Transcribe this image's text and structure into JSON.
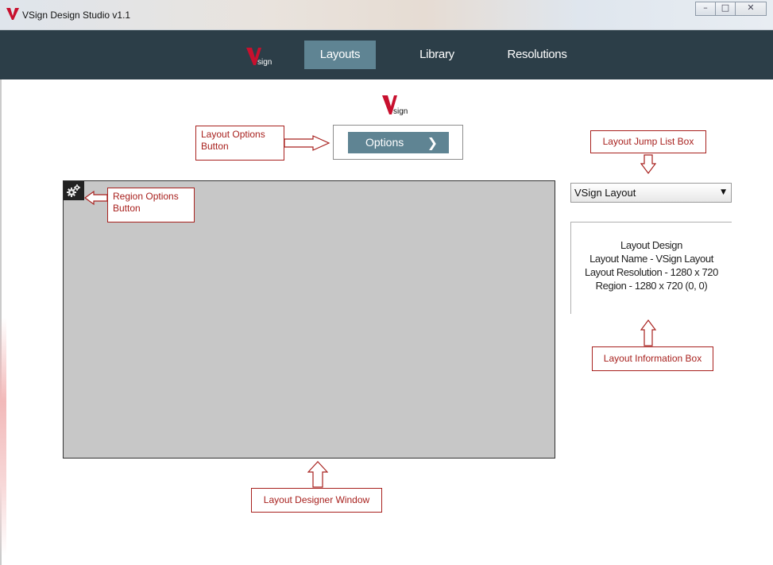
{
  "window": {
    "title": "VSign Design Studio v1.1",
    "controls": {
      "minimize": "–",
      "maximize": "□",
      "close": "✕"
    }
  },
  "nav": {
    "logo_text": "sign",
    "items": [
      {
        "label": "Layouts",
        "active": true
      },
      {
        "label": "Library",
        "active": false
      },
      {
        "label": "Resolutions",
        "active": false
      }
    ]
  },
  "center_logo_text": "sign",
  "options_button": {
    "label": "Options",
    "chevron": "❯"
  },
  "jump_list": {
    "selected": "VSign Layout",
    "caret": "▼"
  },
  "info_box": {
    "lines": [
      "Layout Design",
      "Layout Name - VSign Layout",
      "Layout Resolution - 1280 x 720",
      "Region - 1280 x 720 (0, 0)"
    ]
  },
  "callouts": {
    "layout_options": "Layout Options Button",
    "region_options": "Region Options Button",
    "jump_list": "Layout Jump List Box",
    "info_box": "Layout Information Box",
    "designer": "Layout Designer Window"
  },
  "colors": {
    "brand_red": "#c8102e",
    "navbar": "#2c3e48",
    "active_tab": "#5f8493",
    "callout": "#a8211e",
    "designer_bg": "#c7c7c7"
  }
}
